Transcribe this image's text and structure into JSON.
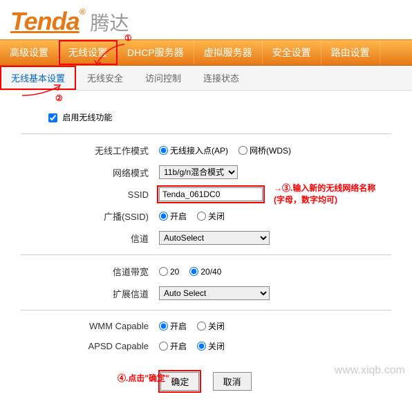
{
  "logo": {
    "brand": "Tenda",
    "cn": "腾达"
  },
  "mainNav": [
    "高级设置",
    "无线设置",
    "DHCP服务器",
    "虚拟服务器",
    "安全设置",
    "路由设置"
  ],
  "subNav": [
    "无线基本设置",
    "无线安全",
    "访问控制",
    "连接状态"
  ],
  "enable": {
    "label": "启用无线功能",
    "checked": true
  },
  "rows": {
    "mode": {
      "label": "无线工作模式",
      "opt1": "无线接入点(AP)",
      "opt2": "网桥(WDS)"
    },
    "netmode": {
      "label": "网络模式",
      "value": "11b/g/n混合模式"
    },
    "ssid": {
      "label": "SSID",
      "value": "Tenda_061DC0"
    },
    "broadcast": {
      "label": "广播(SSID)",
      "opt1": "开启",
      "opt2": "关闭"
    },
    "channel": {
      "label": "信道",
      "value": "AutoSelect"
    },
    "bandwidth": {
      "label": "信道带宽",
      "opt1": "20",
      "opt2": "20/40"
    },
    "extchannel": {
      "label": "扩展信道",
      "value": "Auto Select"
    },
    "wmm": {
      "label": "WMM Capable",
      "opt1": "开启",
      "opt2": "关闭"
    },
    "apsd": {
      "label": "APSD Capable",
      "opt1": "开启",
      "opt2": "关闭"
    }
  },
  "buttons": {
    "ok": "确定",
    "cancel": "取消"
  },
  "annotations": {
    "a1": "①",
    "a2": "②",
    "a3a": "③.输入新的无线网络名称",
    "a3b": "(字母，数字均可)",
    "a4": "④.点击\"确定\""
  },
  "watermark": "www.xiqb.com"
}
